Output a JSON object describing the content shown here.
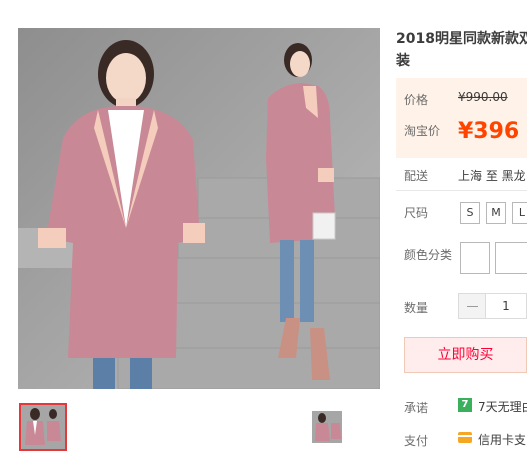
{
  "product": {
    "title_line1": "2018明星同款新款双",
    "title_line2": "装"
  },
  "price": {
    "label": "价格",
    "original": "¥990.00",
    "promo_label": "淘宝价",
    "current": "¥396"
  },
  "delivery": {
    "label": "配送",
    "route": "上海 至  黑龙"
  },
  "size": {
    "label": "尺码",
    "options": [
      "S",
      "M",
      "L"
    ]
  },
  "color": {
    "label": "颜色分类"
  },
  "quantity": {
    "label": "数量",
    "value": "1"
  },
  "buy_label": "立即购买",
  "promise": {
    "label": "承诺",
    "text": "7天无理由",
    "icon_text": "7"
  },
  "payment": {
    "label": "支付",
    "text": "信用卡支"
  },
  "colors": {
    "price": "#ff4400",
    "buy_button_bg": "#ffeded",
    "buy_button_text": "#ff0036",
    "price_bg": "#fff2e8",
    "coat": "#c98896"
  },
  "icons": {
    "promise": "seven-day-return-icon",
    "payment": "credit-card-icon"
  }
}
